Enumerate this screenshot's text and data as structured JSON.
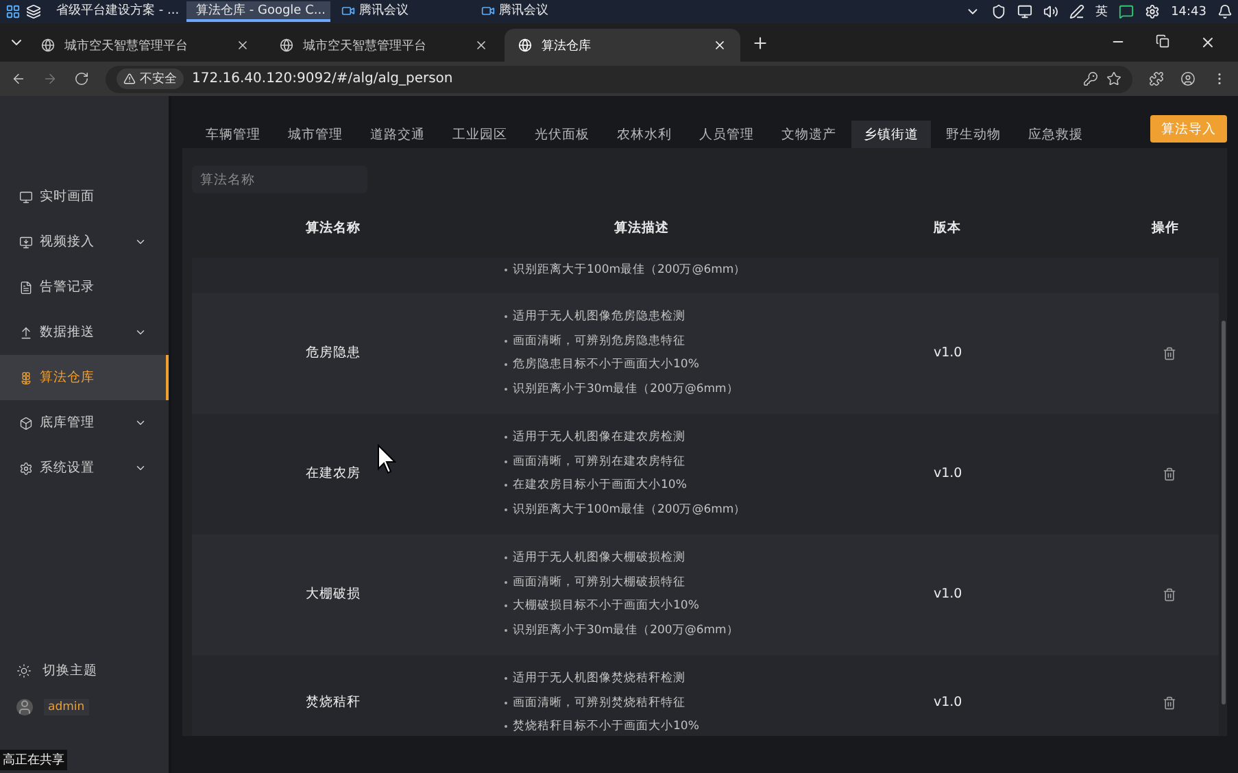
{
  "taskbar": {
    "apps": [
      {
        "label": "省级平台建设方案 - ...",
        "selected": false
      },
      {
        "label": "算法仓库 - Google C...",
        "selected": true
      },
      {
        "label": "腾讯会议",
        "selected": false
      },
      {
        "label": "腾讯会议",
        "selected": false
      }
    ],
    "ime": "英",
    "clock": "14:43"
  },
  "browser": {
    "tabs": [
      {
        "title": "城市空天智慧管理平台",
        "selected": false
      },
      {
        "title": "城市空天智慧管理平台",
        "selected": false
      },
      {
        "title": "算法仓库",
        "selected": true
      }
    ],
    "security_badge": "不安全",
    "url": "172.16.40.120:9092/#/alg/alg_person"
  },
  "sidebar": {
    "items": [
      {
        "label": "实时画面",
        "expandable": false,
        "selected": false
      },
      {
        "label": "视频接入",
        "expandable": true,
        "selected": false
      },
      {
        "label": "告警记录",
        "expandable": false,
        "selected": false
      },
      {
        "label": "数据推送",
        "expandable": true,
        "selected": false
      },
      {
        "label": "算法仓库",
        "expandable": false,
        "selected": true
      },
      {
        "label": "底库管理",
        "expandable": true,
        "selected": false
      },
      {
        "label": "系统设置",
        "expandable": true,
        "selected": false
      }
    ],
    "theme_toggle": "切换主题",
    "user": "admin"
  },
  "category_tabs": [
    {
      "label": "车辆管理",
      "selected": false
    },
    {
      "label": "城市管理",
      "selected": false
    },
    {
      "label": "道路交通",
      "selected": false
    },
    {
      "label": "工业园区",
      "selected": false
    },
    {
      "label": "光伏面板",
      "selected": false
    },
    {
      "label": "农林水利",
      "selected": false
    },
    {
      "label": "人员管理",
      "selected": false
    },
    {
      "label": "文物遗产",
      "selected": false
    },
    {
      "label": "乡镇街道",
      "selected": true
    },
    {
      "label": "野生动物",
      "selected": false
    },
    {
      "label": "应急救援",
      "selected": false
    }
  ],
  "import_button": "算法导入",
  "search": {
    "placeholder": "算法名称"
  },
  "table": {
    "columns": [
      "算法名称",
      "算法描述",
      "版本",
      "操作"
    ],
    "rows": [
      {
        "description": [
          "识别距离大于100m最佳（200万@6mm）"
        ]
      },
      {
        "name": "危房隐患",
        "description": [
          "适用于无人机图像危房隐患检测",
          "画面清晰，可辨别危房隐患特征",
          "危房隐患目标不小于画面大小10%",
          "识别距离小于30m最佳（200万@6mm）"
        ],
        "version": "v1.0"
      },
      {
        "name": "在建农房",
        "description": [
          "适用于无人机图像在建农房检测",
          "画面清晰，可辨别在建农房特征",
          "在建农房目标小于画面大小10%",
          "识别距离大于100m最佳（200万@6mm）"
        ],
        "version": "v1.0"
      },
      {
        "name": "大棚破损",
        "description": [
          "适用于无人机图像大棚破损检测",
          "画面清晰，可辨别大棚破损特征",
          "大棚破损目标不小于画面大小10%",
          "识别距离小于30m最佳（200万@6mm）"
        ],
        "version": "v1.0"
      },
      {
        "name": "焚烧秸秆",
        "description": [
          "适用于无人机图像焚烧秸秆检测",
          "画面清晰，可辨别焚烧秸秆特征",
          "焚烧秸秆目标不小于画面大小10%"
        ],
        "version": "v1.0"
      }
    ]
  },
  "share_notice": "高正在共享"
}
